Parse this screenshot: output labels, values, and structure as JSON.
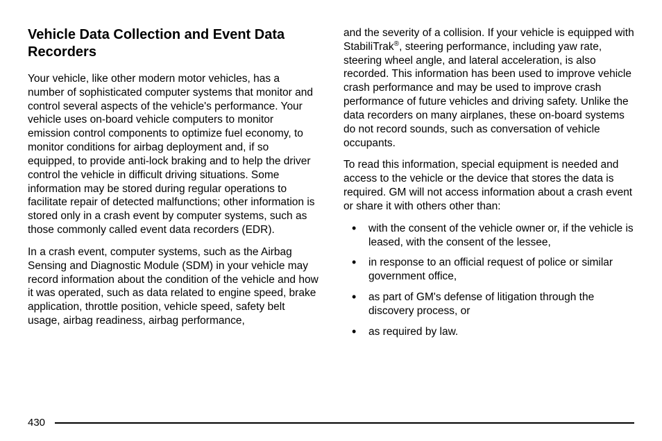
{
  "heading": "Vehicle Data Collection and Event Data Recorders",
  "col1": {
    "p1": "Your vehicle, like other modern motor vehicles, has a number of sophisticated computer systems that monitor and control several aspects of the vehicle's performance. Your vehicle uses on-board vehicle computers to monitor emission control components to optimize fuel economy, to monitor conditions for airbag deployment and, if so equipped, to provide anti-lock braking and to help the driver control the vehicle in difficult driving situations. Some information may be stored during regular operations to facilitate repair of detected malfunctions; other information is stored only in a crash event by computer systems, such as those commonly called event data recorders (EDR).",
    "p2": "In a crash event, computer systems, such as the Airbag Sensing and Diagnostic Module (SDM) in your vehicle may record information about the condition of the vehicle and how it was operated, such as data related to engine speed, brake application, throttle position, vehicle speed, safety belt usage, airbag readiness, airbag performance,"
  },
  "col2": {
    "p1a": "and the severity of a collision. If your vehicle is equipped with StabiliTrak",
    "p1_sup": "®",
    "p1b": ", steering performance, including yaw rate, steering wheel angle, and lateral acceleration, is also recorded. This information has been used to improve vehicle crash performance and may be used to improve crash performance of future vehicles and driving safety. Unlike the data recorders on many airplanes, these on-board systems do not record sounds, such as conversation of vehicle occupants.",
    "p2": "To read this information, special equipment is needed and access to the vehicle or the device that stores the data is required. GM will not access information about a crash event or share it with others other than:",
    "bullets": [
      "with the consent of the vehicle owner or, if the vehicle is leased, with the consent of the lessee,",
      "in response to an official request of police or similar government office,",
      "as part of GM's defense of litigation through the discovery process, or",
      "as required by law."
    ]
  },
  "page_number": "430"
}
